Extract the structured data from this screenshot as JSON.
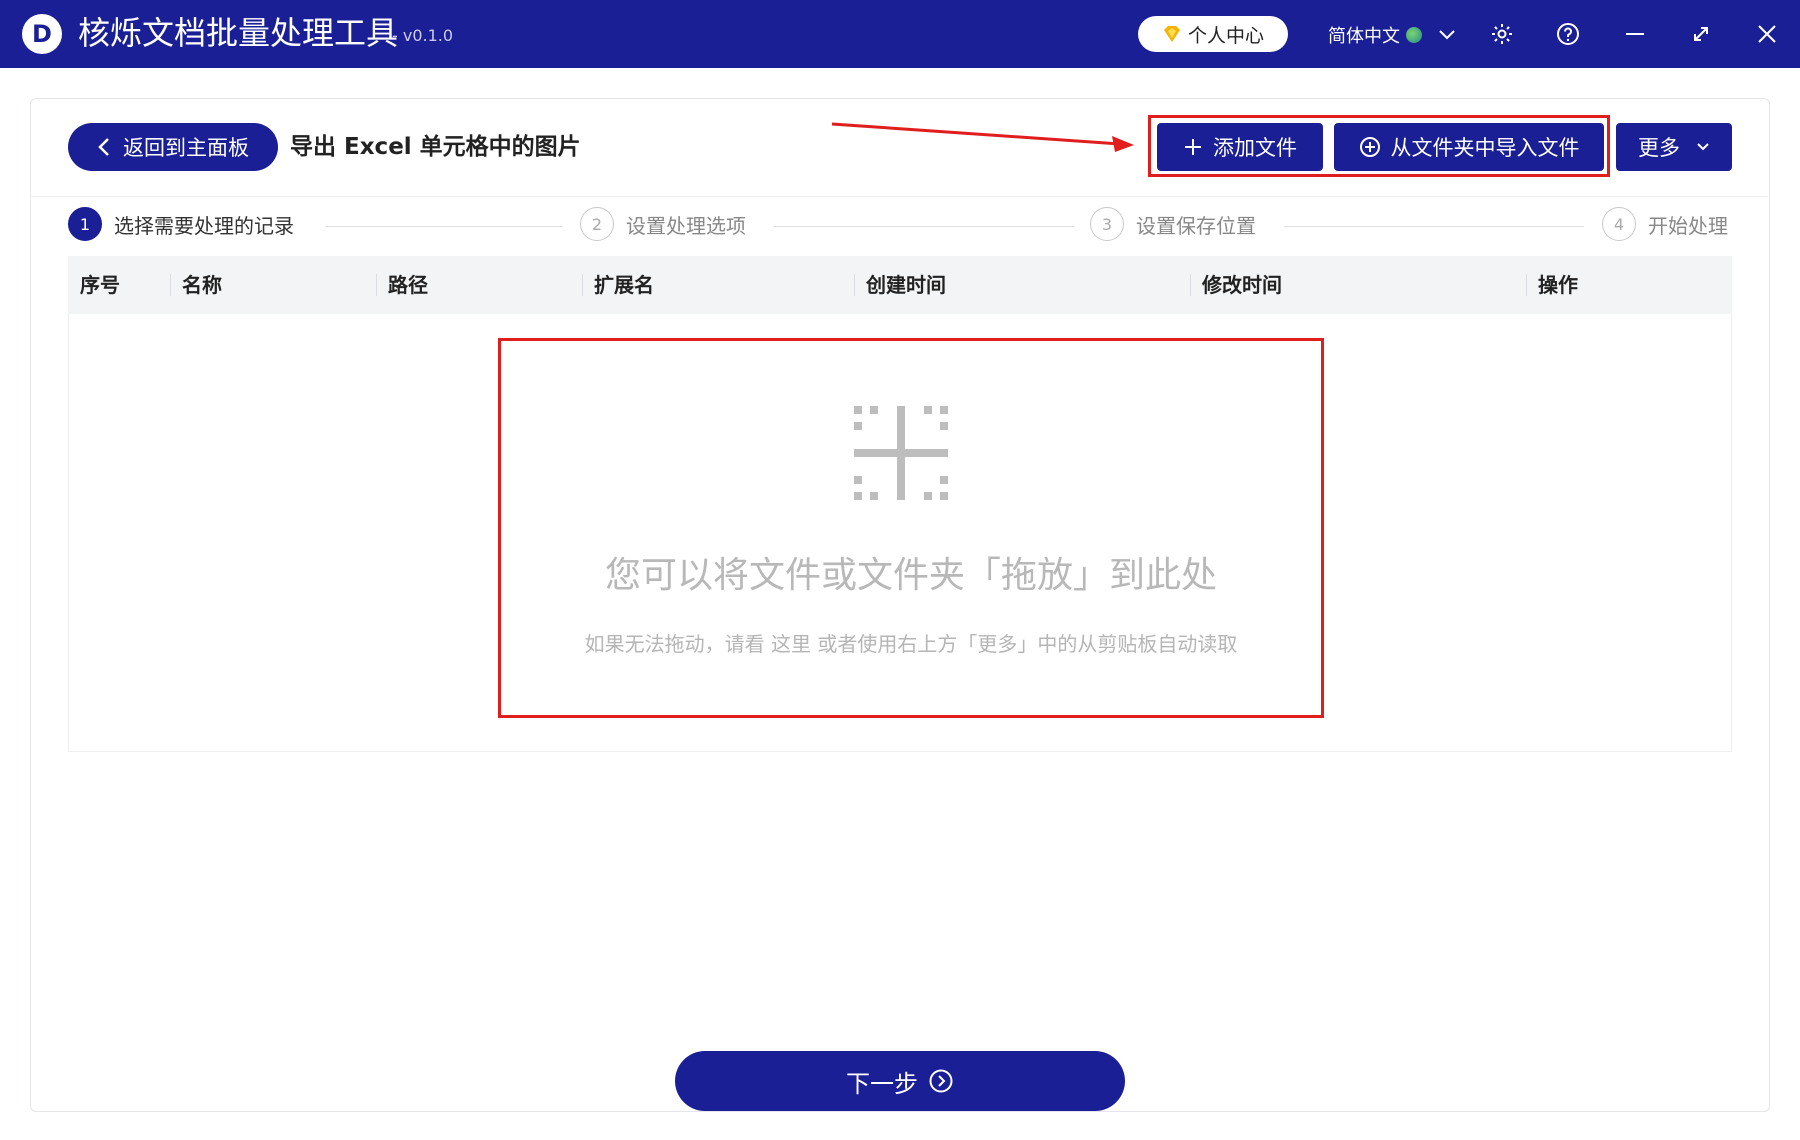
{
  "app": {
    "logo_letter": "D",
    "title": "核烁文档批量处理工具",
    "version": "- v0.1.0",
    "user_center": "个人中心",
    "language": "简体中文"
  },
  "header": {
    "back_label": "返回到主面板",
    "page_title": "导出 Excel 单元格中的图片",
    "add_file": "添加文件",
    "import_folder": "从文件夹中导入文件",
    "more": "更多"
  },
  "steps": [
    {
      "num": "1",
      "label": "选择需要处理的记录",
      "active": true
    },
    {
      "num": "2",
      "label": "设置处理选项",
      "active": false
    },
    {
      "num": "3",
      "label": "设置保存位置",
      "active": false
    },
    {
      "num": "4",
      "label": "开始处理",
      "active": false
    }
  ],
  "table": {
    "columns": [
      "序号",
      "名称",
      "路径",
      "扩展名",
      "创建时间",
      "修改时间",
      "操作"
    ]
  },
  "dropzone": {
    "main_text": "您可以将文件或文件夹「拖放」到此处",
    "sub_text": "如果无法拖动，请看  这里  或者使用右上方「更多」中的从剪贴板自动读取"
  },
  "footer": {
    "next_label": "下一步"
  },
  "colors": {
    "primary": "#1a1f96",
    "highlight": "#e01e1e",
    "gem": "#f5b400"
  },
  "icons": [
    "logo-icon",
    "gem-icon",
    "globe-icon",
    "chevron-down-icon",
    "gear-icon",
    "help-icon",
    "minimize-icon",
    "maximize-icon",
    "close-icon",
    "chevron-left-icon",
    "plus-icon",
    "plus-circle-icon",
    "drop-target-icon",
    "arrow-right-circle-icon"
  ]
}
